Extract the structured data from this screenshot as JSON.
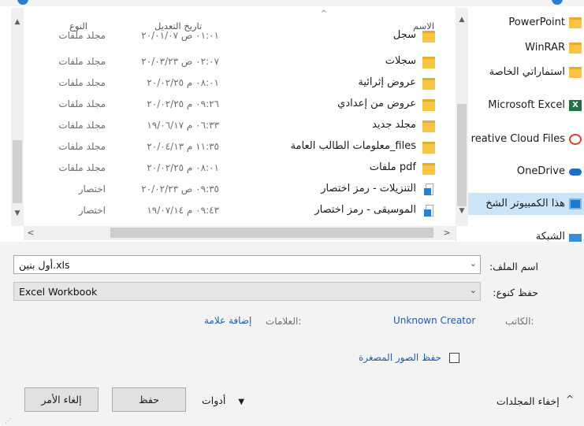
{
  "columns": {
    "type": "النوع",
    "date_modified": "تاريخ التعديل",
    "name": "الاسم"
  },
  "files": [
    {
      "name": "سجل",
      "date": "٠١:٠١ ص ٢٠/٠١/٠٧",
      "type": "مجلد ملفات",
      "icon": "folder-icon"
    },
    {
      "name": "سجلات",
      "date": "٠٢:٠٧ ص ٢٠/٠٣/٢٣",
      "type": "مجلد ملفات",
      "icon": "folder-icon"
    },
    {
      "name": "عروض إثرائية",
      "date": "٠٨:٠١ م ٢٠/٠٢/٢٥",
      "type": "مجلد ملفات",
      "icon": "folder-icon"
    },
    {
      "name": "عروض من إعدادي",
      "date": "٠٩:٢٦ م ٢٠/٠٢/٢٥",
      "type": "مجلد ملفات",
      "icon": "folder-icon"
    },
    {
      "name": "مجلد جديد",
      "date": "٠٦:٣٣ م ١٩/٠٦/١٧",
      "type": "مجلد ملفات",
      "icon": "folder-icon"
    },
    {
      "name": "files_معلومات الطالب العامة",
      "date": "١١:٣٥ م ٢٠/٠٤/١٣",
      "type": "مجلد ملفات",
      "icon": "folder-icon"
    },
    {
      "name": "pdf ملفات",
      "date": "٠٨:٠١ م ٢٠/٠٢/٢٥",
      "type": "مجلد ملفات",
      "icon": "folder-icon"
    },
    {
      "name": "التنزيلات - رمز اختصار",
      "date": "٠٩:٣٥ ص ٢٠/٠٢/٢٣",
      "type": "اختصار",
      "icon": "download-shortcut-icon"
    },
    {
      "name": "الموسيقى - رمز اختصار",
      "date": "٠٩:٤٣ م ١٩/٠٧/١٤",
      "type": "اختصار",
      "icon": "music-shortcut-icon"
    }
  ],
  "nav": [
    {
      "label": "PowerPoint",
      "icon": "folder-icon"
    },
    {
      "label": "WinRAR",
      "icon": "folder-icon"
    },
    {
      "label": "استماراتي الخاصة",
      "icon": "folder-icon"
    },
    {
      "label": "Microsoft Excel",
      "icon": "excel-icon"
    },
    {
      "label": "reative Cloud Files",
      "icon": "creative-cloud-icon"
    },
    {
      "label": "OneDrive",
      "icon": "onedrive-icon"
    },
    {
      "label": "هذا الكمبيوتر الشخ",
      "icon": "computer-icon",
      "selected": true
    },
    {
      "label": "الشبكة",
      "icon": "network-icon"
    }
  ],
  "form": {
    "filename_label": "اسم الملف:",
    "filename_value": "أول بنين.xls",
    "savetype_label": "حفظ كنوع:",
    "savetype_value": "Excel Workbook",
    "author_label": "الكاتب:",
    "author_value": "Unknown Creator",
    "tags_label": "العلامات:",
    "tags_value": "إضافة علامة",
    "thumbnail_label": "حفظ الصور المصغرة",
    "thumbnail_checked": false
  },
  "footer": {
    "hide_folders": "إخفاء المجلدات",
    "tools": "أدوات",
    "save": "حفظ",
    "cancel": "إلغاء الأمر"
  },
  "colors": {
    "accent": "#2d7dd2",
    "selection": "#cce4f7",
    "link": "#1f5da8",
    "excel": "#1f7244"
  }
}
